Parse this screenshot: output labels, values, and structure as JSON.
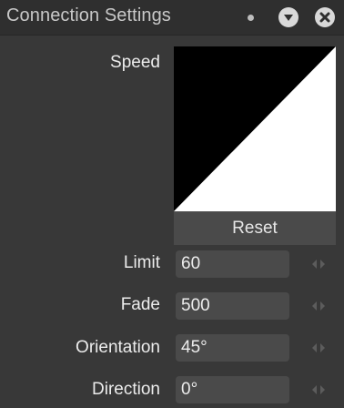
{
  "window": {
    "title": "Connection Settings"
  },
  "speed": {
    "label": "Speed",
    "reset_label": "Reset"
  },
  "fields": [
    {
      "label": "Limit",
      "value": "60"
    },
    {
      "label": "Fade",
      "value": "500"
    },
    {
      "label": "Orientation",
      "value": "45°"
    },
    {
      "label": "Direction",
      "value": "0°"
    }
  ],
  "icons": {
    "menu_dot": "dot-icon",
    "collapse": "chevron-down-icon",
    "close": "close-icon",
    "stepper": "stepper-arrows-icon"
  },
  "colors": {
    "panel_bg": "#383838",
    "titlebar_bg": "#2f2f2f",
    "field_bg": "#4a4a4a",
    "curve_fill": "#ffffff",
    "curve_bg": "#000000"
  }
}
